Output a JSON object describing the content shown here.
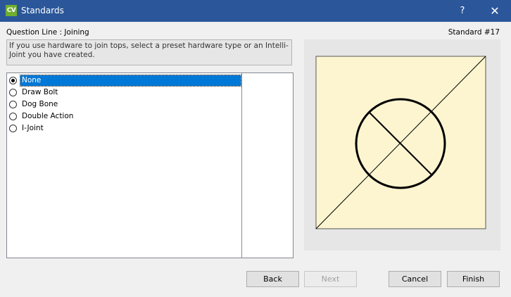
{
  "window": {
    "app_icon_text": "CV",
    "title": "Standards",
    "help_label": "?",
    "close_label": "✕"
  },
  "header": {
    "question_line": "Question Line : Joining",
    "standard_number": "Standard #17"
  },
  "description": "If you use hardware to join tops, select a preset hardware type or an Intelli-Joint you have created.",
  "options": [
    {
      "label": "None",
      "selected": true
    },
    {
      "label": "Draw Bolt",
      "selected": false
    },
    {
      "label": "Dog Bone",
      "selected": false
    },
    {
      "label": "Double Action",
      "selected": false
    },
    {
      "label": "I-Joint",
      "selected": false
    }
  ],
  "preview": {
    "background_color": "#fdf5d0",
    "stroke_color": "#000000",
    "icon": "draw-bolt-joint-symbol"
  },
  "buttons": {
    "back": "Back",
    "next": "Next",
    "cancel": "Cancel",
    "finish": "Finish"
  },
  "colors": {
    "titlebar": "#2b579a",
    "selection": "#0078d7",
    "app_icon": "#6fae2f"
  }
}
